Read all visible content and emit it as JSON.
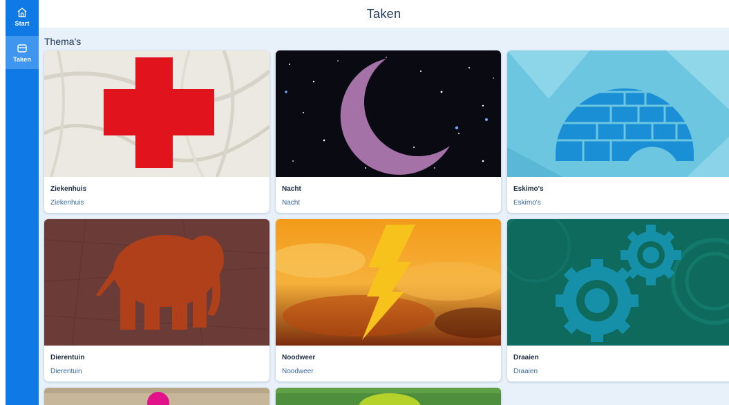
{
  "header": {
    "title": "Taken"
  },
  "sidebar": {
    "items": [
      {
        "label": "Start",
        "icon": "home-icon"
      },
      {
        "label": "Taken",
        "icon": "tasks-icon"
      }
    ]
  },
  "section": {
    "title": "Thema's"
  },
  "cards": [
    {
      "title": "Ziekenhuis",
      "subtitle": "Ziekenhuis",
      "icon": "red-cross-icon"
    },
    {
      "title": "Nacht",
      "subtitle": "Nacht",
      "icon": "moon-icon"
    },
    {
      "title": "Eskimo's",
      "subtitle": "Eskimo's",
      "icon": "igloo-icon"
    },
    {
      "title": "Dierentuin",
      "subtitle": "Dierentuin",
      "icon": "elephant-icon"
    },
    {
      "title": "Noodweer",
      "subtitle": "Noodweer",
      "icon": "lightning-icon"
    },
    {
      "title": "Draaien",
      "subtitle": "Draaien",
      "icon": "gears-icon"
    }
  ],
  "colors": {
    "sidebar": "#0f7ae5",
    "sidebar_active": "#3f96ee",
    "background": "#e8f1fa",
    "title_text": "#1d3557",
    "subtitle_text": "#3a6a9a"
  }
}
